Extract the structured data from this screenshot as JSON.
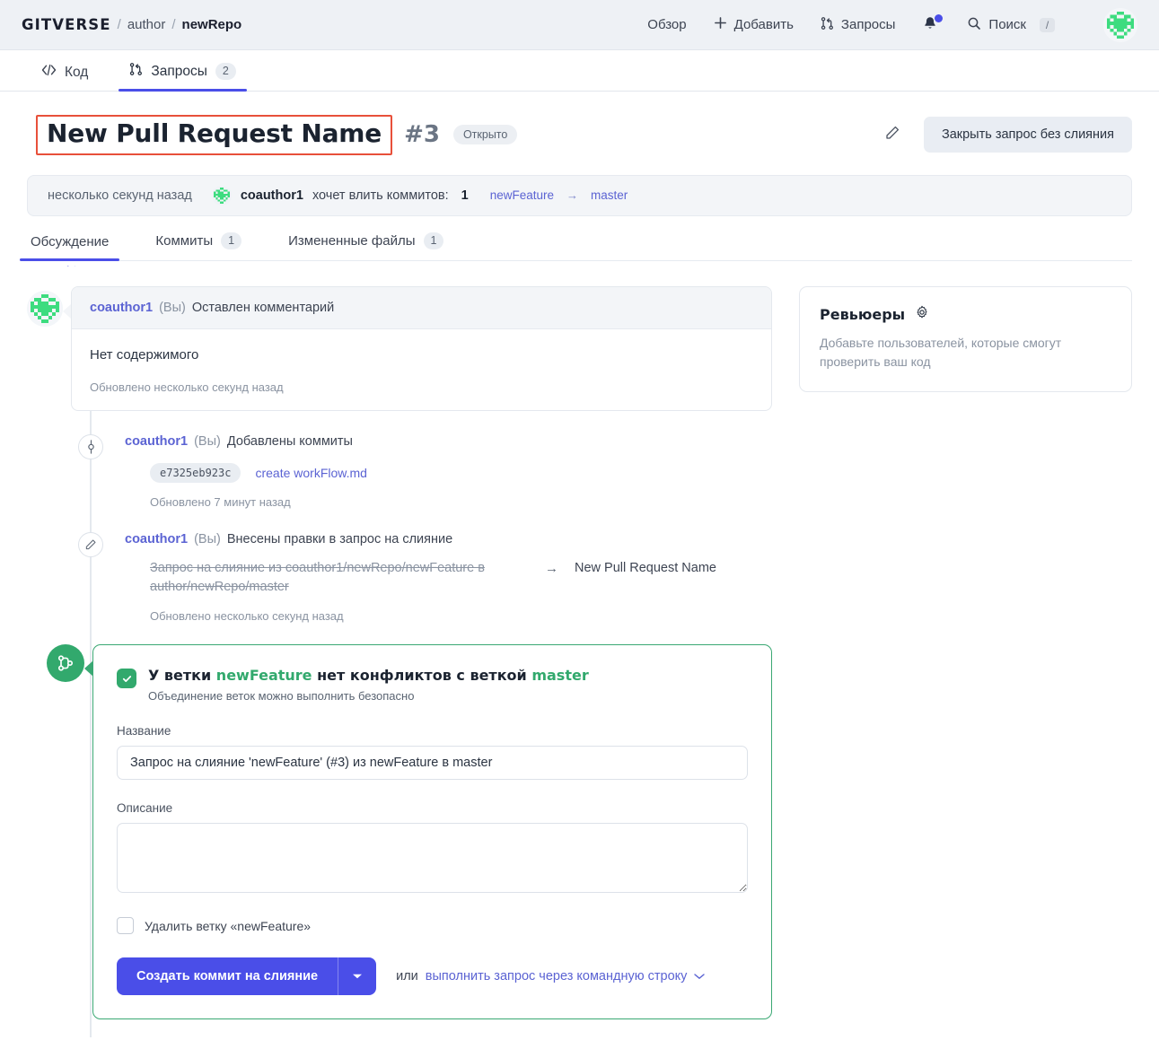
{
  "header": {
    "brand": "GITVERSE",
    "sep": "/",
    "owner": "author",
    "repo": "newRepo",
    "nav": {
      "overview": "Обзор",
      "add": "Добавить",
      "requests": "Запросы",
      "search": "Поиск",
      "search_key": "/"
    }
  },
  "repo_tabs": [
    {
      "label": "Код",
      "icon": "code-icon",
      "count": ""
    },
    {
      "label": "Запросы",
      "icon": "pull-request-icon",
      "count": "2"
    }
  ],
  "pr": {
    "title": "New Pull Request Name",
    "number": "#3",
    "status": "Открыто",
    "close_button": "Закрыть запрос без слияния",
    "edit_icon": "pencil-icon"
  },
  "meta": {
    "time": "несколько секунд назад",
    "user": "coauthor1",
    "action": "хочет влить коммитов:",
    "count": "1",
    "source_branch": "newFeature",
    "arrow": "→",
    "target_branch": "master"
  },
  "sub_tabs": [
    {
      "label": "Обсуждение",
      "count": ""
    },
    {
      "label": "Коммиты",
      "count": "1"
    },
    {
      "label": "Измененные файлы",
      "count": "1"
    }
  ],
  "comment": {
    "user": "coauthor1",
    "you": "(Вы)",
    "action": "Оставлен комментарий",
    "body": "Нет содержимого",
    "updated": "Обновлено несколько секунд назад"
  },
  "events": [
    {
      "icon": "commit-icon",
      "user": "coauthor1",
      "you": "(Вы)",
      "action": "Добавлены коммиты",
      "sha": "e7325eb923c",
      "message": "create workFlow.md",
      "updated": "Обновлено 7 минут назад"
    },
    {
      "icon": "pencil-icon",
      "user": "coauthor1",
      "you": "(Вы)",
      "action": "Внесены правки в запрос на слияние",
      "old_title": "Запрос на слияние из coauthor1/newRepo/newFeature в author/newRepo/master",
      "arrow": "→",
      "new_title": "New Pull Request Name",
      "updated": "Обновлено несколько секунд назад"
    }
  ],
  "merge": {
    "icon": "merge-icon",
    "check_icon": "check-icon",
    "headline_pre": "У ветки ",
    "source_branch": "newFeature",
    "headline_mid": " нет конфликтов с веткой ",
    "target_branch": "master",
    "subtitle": "Объединение веток можно выполнить безопасно",
    "name_label": "Название",
    "name_value": "Запрос на слияние 'newFeature' (#3) из newFeature в master",
    "desc_label": "Описание",
    "desc_value": "",
    "delete_branch_label": "Удалить ветку «newFeature»",
    "primary_button": "Создать коммит на слияние",
    "dropdown_icon": "chevron-down-icon",
    "or_text": "или",
    "cmd_link": "выполнить запрос через командную строку",
    "cmd_chevron": "chevron-down-icon"
  },
  "reviewers": {
    "title": "Ревьюеры",
    "gear_icon": "gear-icon",
    "description": "Добавьте пользователей, которые смогут проверить ваш код"
  },
  "colors": {
    "accent": "#4a4ee8",
    "link": "#5b63d3",
    "green": "#32a96d",
    "annotation": "#e8503a",
    "header_bg": "#eef1f5"
  }
}
